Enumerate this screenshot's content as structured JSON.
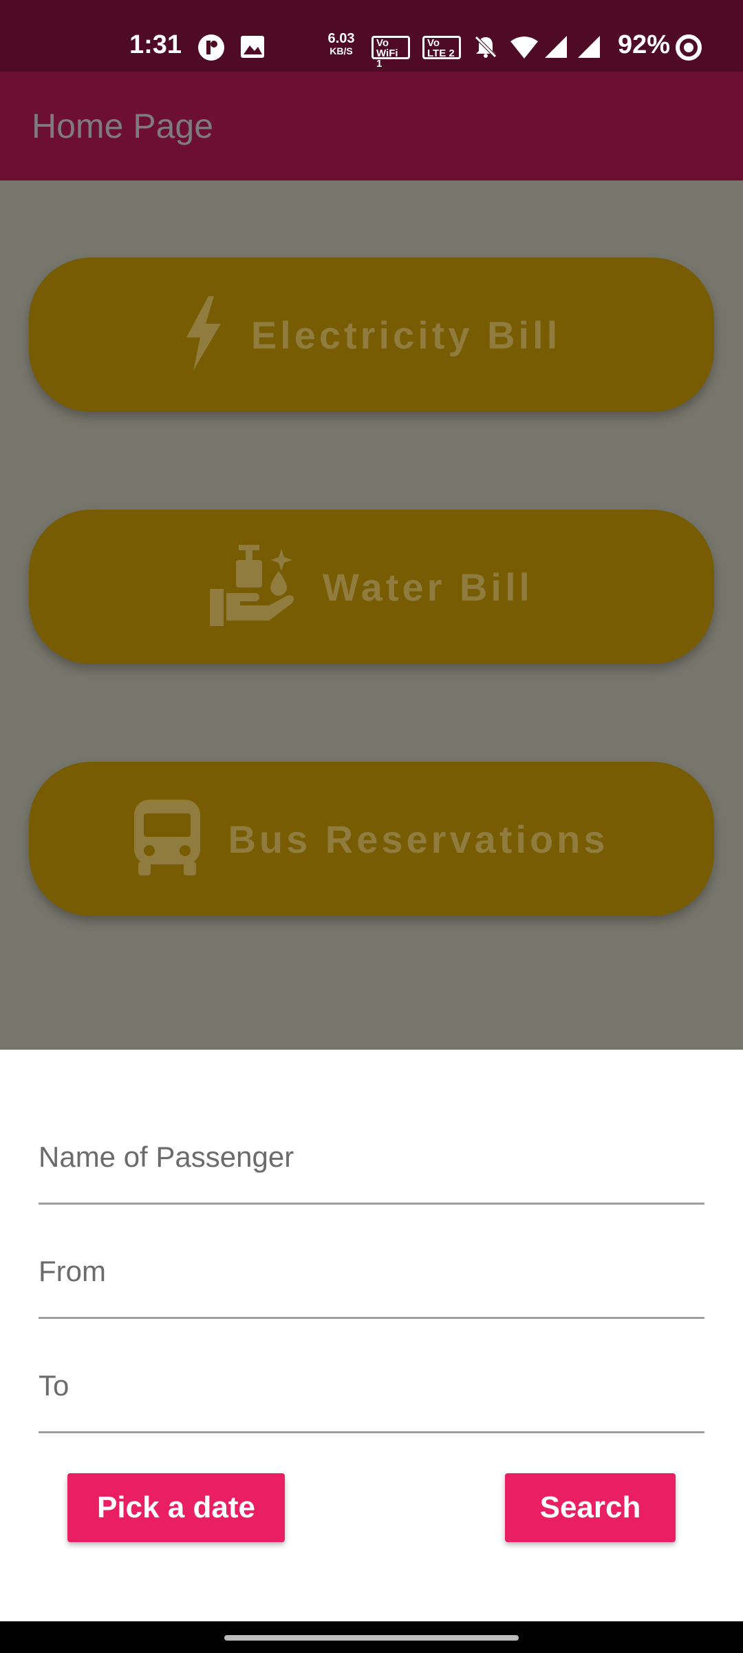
{
  "status_bar": {
    "time": "1:31",
    "net_speed": "6.03",
    "net_speed_unit": "KB/S",
    "wifi_badge": "Vo WiFi 1",
    "lte_badge": "Vo LTE 2",
    "battery": "92%",
    "icons": [
      "notification-icon",
      "gallery-icon",
      "mute-icon",
      "wifi-icon",
      "signal-icon",
      "signal-icon",
      "battery-ring-icon"
    ]
  },
  "app_bar": {
    "title": "Home Page"
  },
  "menu": {
    "items": [
      {
        "label": "Electricity Bill",
        "icon": "lightning-icon"
      },
      {
        "label": "Water Bill",
        "icon": "hand-wash-icon"
      },
      {
        "label": "Bus Reservations",
        "icon": "bus-icon"
      }
    ]
  },
  "sheet": {
    "fields": [
      {
        "placeholder": "Name of Passenger",
        "value": ""
      },
      {
        "placeholder": "From",
        "value": ""
      },
      {
        "placeholder": "To",
        "value": ""
      }
    ],
    "pick_date_label": "Pick a date",
    "search_label": "Search"
  },
  "colors": {
    "status_bar": "#4f0a24",
    "app_bar": "#6d0f32",
    "scrim": "#76766c",
    "menu_button": "#775c04",
    "accent": "#e91e63"
  }
}
